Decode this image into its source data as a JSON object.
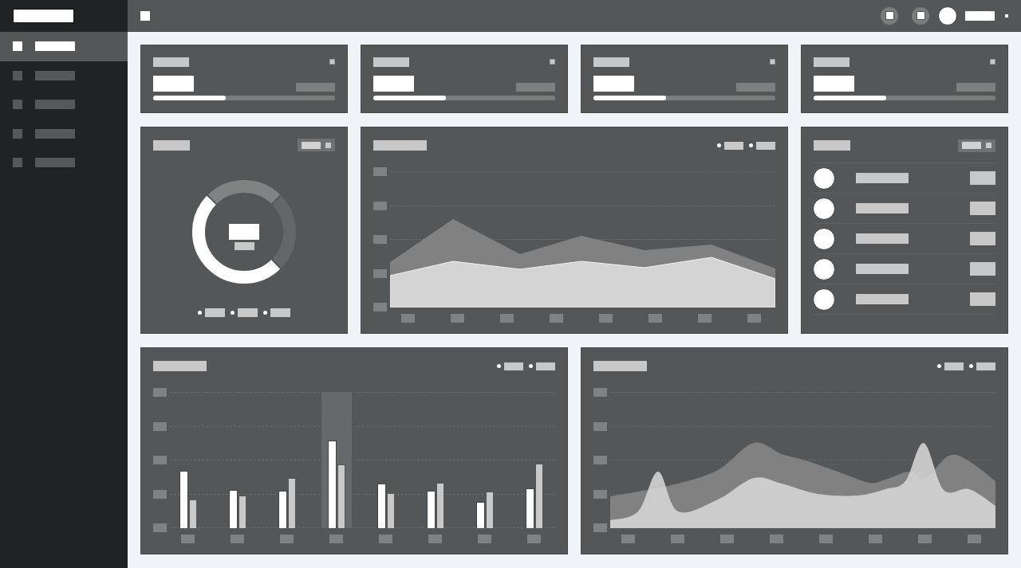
{
  "sidebar": {
    "items": [
      {
        "selected": true
      },
      {
        "selected": false
      },
      {
        "selected": false
      },
      {
        "selected": false
      },
      {
        "selected": false
      }
    ]
  },
  "stat_cards": [
    {
      "level": 0.4
    },
    {
      "level": 0.4
    },
    {
      "level": 0.4
    },
    {
      "level": 0.4
    }
  ],
  "bar_chart": {
    "groups": [
      {
        "selected": false
      },
      {
        "selected": false
      },
      {
        "selected": false
      },
      {
        "selected": true
      },
      {
        "selected": false
      },
      {
        "selected": false
      },
      {
        "selected": false
      },
      {
        "selected": false
      }
    ]
  }
}
